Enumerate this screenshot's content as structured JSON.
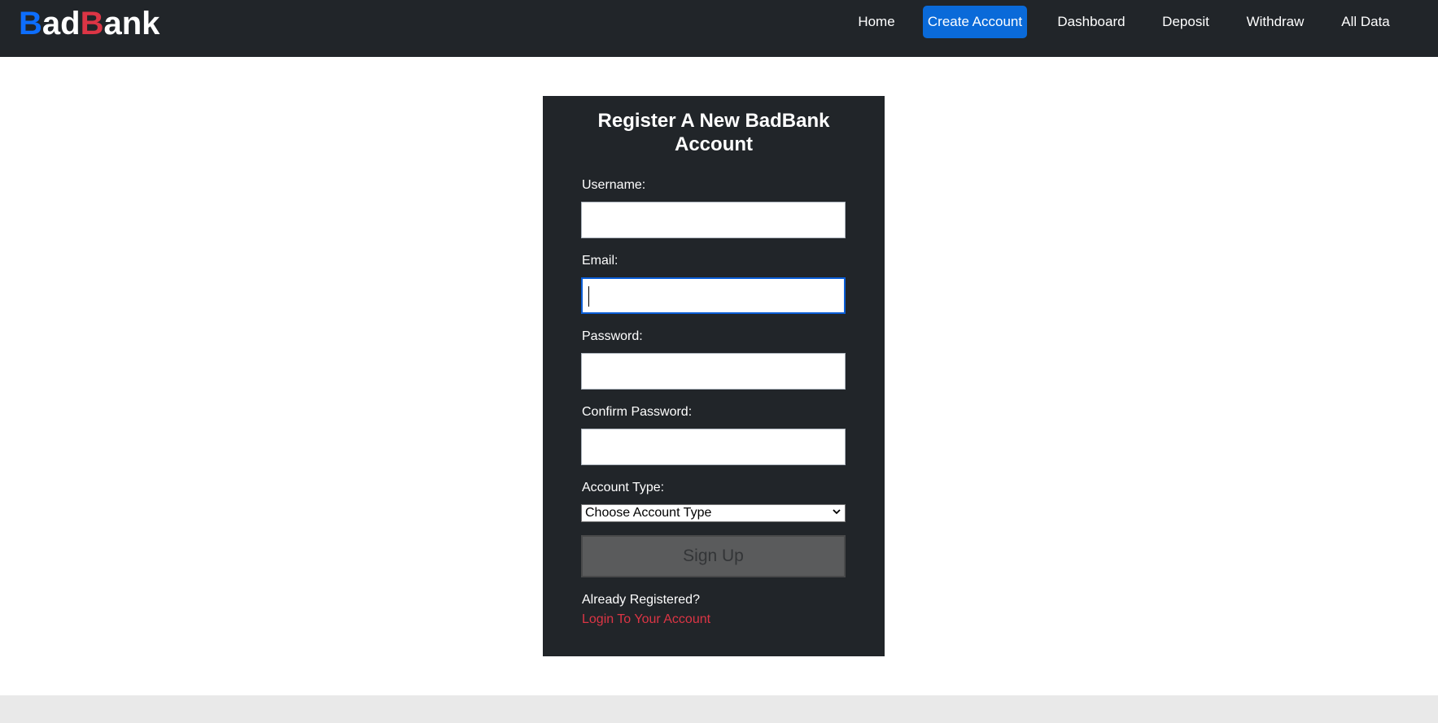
{
  "brand": {
    "part1_letter": "B",
    "part1_rest": "ad",
    "part2_letter": "B",
    "part2_rest": "ank",
    "colors": {
      "first_b": "#0d6efd",
      "second_b": "#dc3545"
    }
  },
  "nav": {
    "items": [
      {
        "label": "Home",
        "active": false
      },
      {
        "label": "Create Account",
        "active": true
      },
      {
        "label": "Dashboard",
        "active": false
      },
      {
        "label": "Deposit",
        "active": false
      },
      {
        "label": "Withdraw",
        "active": false
      },
      {
        "label": "All Data",
        "active": false
      }
    ]
  },
  "form": {
    "title": "Register A New BadBank Account",
    "username_label": "Username:",
    "username_value": "",
    "email_label": "Email:",
    "email_value": "",
    "password_label": "Password:",
    "password_value": "",
    "confirm_label": "Confirm Password:",
    "confirm_value": "",
    "account_type_label": "Account Type:",
    "account_type_selected": "Choose Account Type",
    "signup_label": "Sign Up",
    "already_text": "Already Registered?",
    "login_link": "Login To Your Account"
  },
  "colors": {
    "navbar_bg": "#212529",
    "accent": "#0d6efd",
    "link_red": "#dc3545",
    "footer_bg": "#e9e9e9"
  }
}
